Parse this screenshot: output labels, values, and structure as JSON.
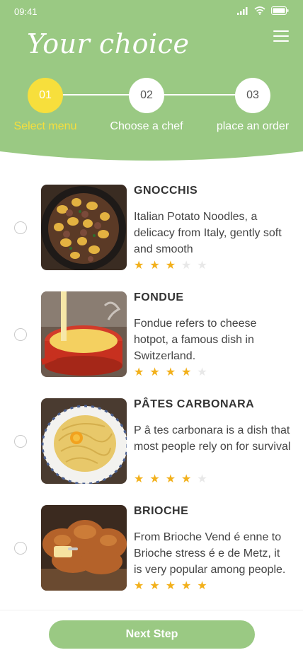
{
  "status_bar": {
    "time": "09:41"
  },
  "header": {
    "title": "Your choice",
    "color": "#9ac983"
  },
  "steps": [
    {
      "number": "01",
      "label": "Select menu",
      "active": true
    },
    {
      "number": "02",
      "label": "Choose a chef",
      "active": false
    },
    {
      "number": "03",
      "label": "place an order",
      "active": false
    }
  ],
  "dishes": [
    {
      "name": "GNOCCHIS",
      "description": "Italian Potato Noodles, a delicacy from Italy, gently soft and smooth",
      "rating": 3,
      "max_rating": 5
    },
    {
      "name": "FONDUE",
      "description": "Fondue refers to cheese hotpot, a famous dish in Switzerland.",
      "rating": 4,
      "max_rating": 5
    },
    {
      "name": "PÂTES CARBONARA",
      "description": "P â tes carbonara is a dish that most people rely on for survival",
      "rating": 4,
      "max_rating": 5
    },
    {
      "name": "BRIOCHE",
      "description": "From Brioche Vend é enne to Brioche stress é e de Metz, it is very popular among people.",
      "rating": 5,
      "max_rating": 5
    }
  ],
  "footer": {
    "next_label": "Next Step"
  },
  "colors": {
    "accent": "#9ac983",
    "active_step": "#f7df3c",
    "star": "#f2b01b"
  }
}
